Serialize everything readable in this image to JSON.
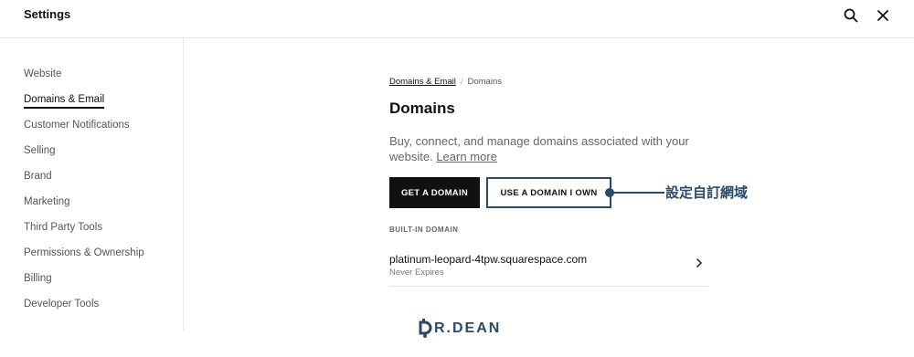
{
  "app": {
    "title": "Settings"
  },
  "sidebar": {
    "items": [
      {
        "label": "Website"
      },
      {
        "label": "Domains & Email"
      },
      {
        "label": "Customer Notifications"
      },
      {
        "label": "Selling"
      },
      {
        "label": "Brand"
      },
      {
        "label": "Marketing"
      },
      {
        "label": "Third Party Tools"
      },
      {
        "label": "Permissions & Ownership"
      },
      {
        "label": "Billing"
      },
      {
        "label": "Developer Tools"
      }
    ],
    "active": "Domains & Email"
  },
  "breadcrumb": {
    "parent": "Domains & Email",
    "separator": "/",
    "current": "Domains"
  },
  "main": {
    "title": "Domains",
    "description": "Buy, connect, and manage domains associated with your website.",
    "learn_more": "Learn more",
    "get_domain_button": "GET A DOMAIN",
    "use_domain_button": "USE A DOMAIN I OWN",
    "section_label": "BUILT-IN DOMAIN",
    "domain": {
      "name": "platinum-leopard-4tpw.squarespace.com",
      "status": "Never Expires"
    }
  },
  "annotation": {
    "text": "設定自訂網域"
  },
  "watermark": {
    "text": "R.DEAN"
  },
  "icons": {
    "search": "search-icon",
    "close": "close-icon",
    "chevron": "chevron-right-icon",
    "logo": "dr-dean-logo-icon"
  },
  "colors": {
    "accent": "#2a4a66",
    "primary_button": "#111111"
  }
}
